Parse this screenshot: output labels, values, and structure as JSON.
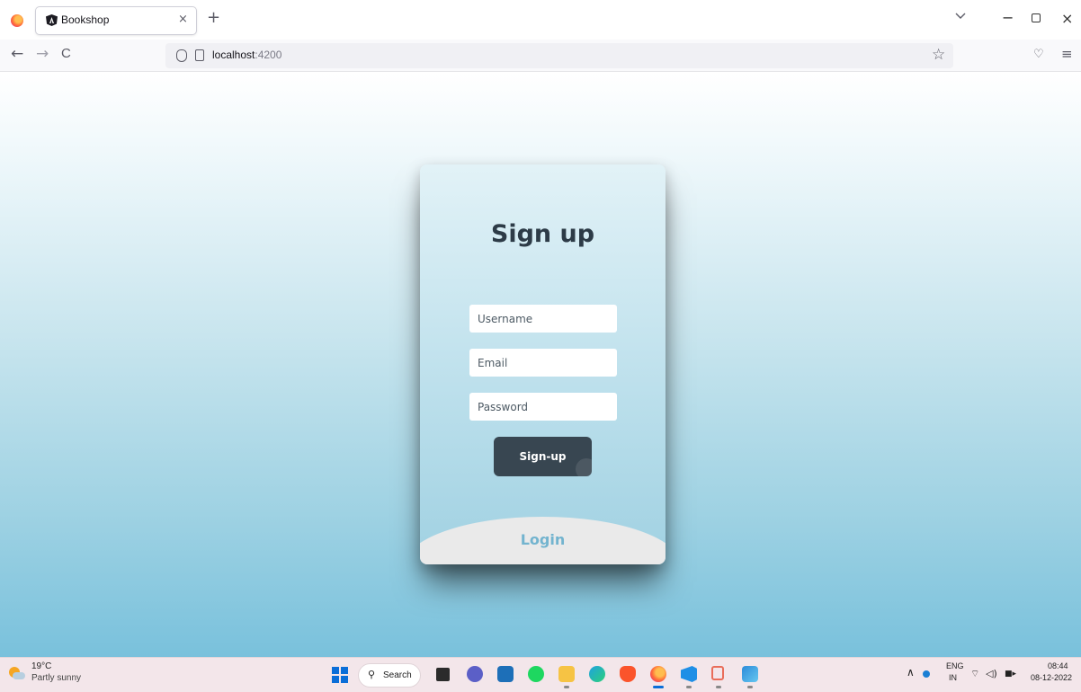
{
  "browser": {
    "tab_title": "Bookshop",
    "tab_close": "×",
    "new_tab": "+",
    "url_host": "localhost",
    "url_port": ":4200"
  },
  "nav": {
    "back": "←",
    "forward": "→",
    "reload": "C"
  },
  "window": {
    "minimize": "−",
    "close": "×"
  },
  "signup": {
    "title": "Sign up",
    "username_placeholder": "Username",
    "email_placeholder": "Email",
    "password_placeholder": "Password",
    "button_label": "Sign-up",
    "login_link": "Login"
  },
  "taskbar": {
    "weather_temp": "19°C",
    "weather_desc": "Partly sunny",
    "search_label": "Search",
    "lang_line1": "ENG",
    "lang_line2": "IN",
    "time": "08:44",
    "date": "08-12-2022"
  },
  "colors": {
    "accent": "#384651",
    "link": "#73b4cf",
    "heading": "#2d3b47"
  },
  "icons": {
    "taskbar_apps": [
      "file-explorer-icon",
      "teams-icon",
      "mail-icon",
      "spotify-icon",
      "folder-icon",
      "edge-icon",
      "brave-icon",
      "firefox-icon",
      "vscode-icon",
      "git-icon",
      "photos-icon"
    ]
  }
}
